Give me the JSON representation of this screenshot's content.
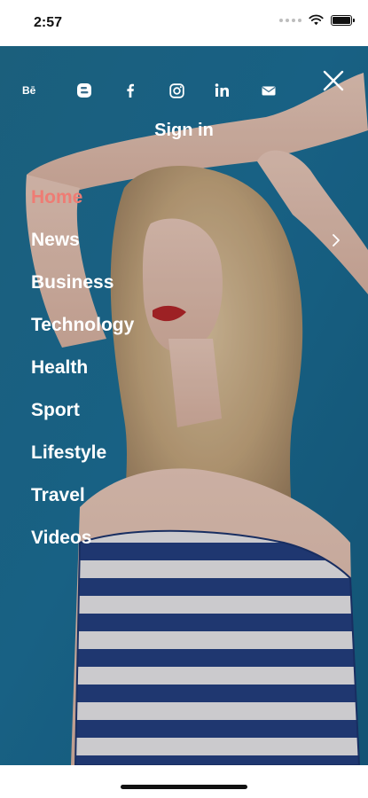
{
  "status_bar": {
    "time": "2:57",
    "icons": [
      "cellular-dots-icon",
      "wifi-icon",
      "battery-icon"
    ]
  },
  "social": {
    "icons": [
      "behance-icon",
      "blogger-icon",
      "facebook-icon",
      "instagram-icon",
      "linkedin-icon",
      "mail-icon"
    ]
  },
  "header": {
    "sign_in": "Sign in"
  },
  "menu": {
    "active_index": 0,
    "items": [
      {
        "label": "Home"
      },
      {
        "label": "News"
      },
      {
        "label": "Business"
      },
      {
        "label": "Technology"
      },
      {
        "label": "Health"
      },
      {
        "label": "Sport"
      },
      {
        "label": "Lifestyle"
      },
      {
        "label": "Travel"
      },
      {
        "label": "Videos"
      }
    ]
  },
  "colors": {
    "active": "#ee7c74",
    "text": "#ffffff",
    "background_blue": "#1f6f93"
  }
}
